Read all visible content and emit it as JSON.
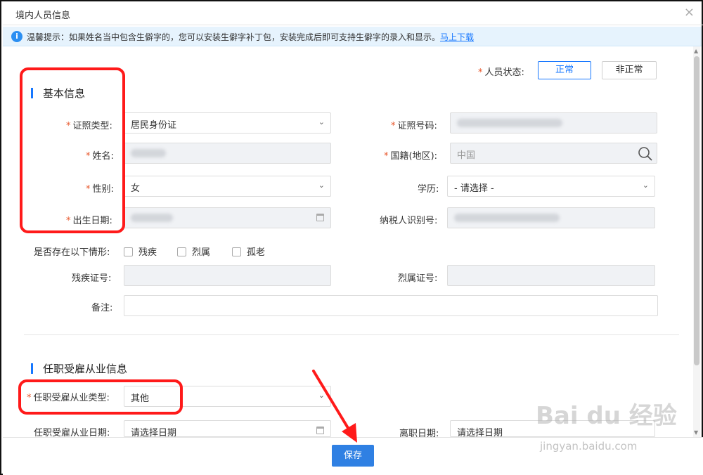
{
  "window": {
    "title": "境内人员信息",
    "close_symbol": "×"
  },
  "tip": {
    "icon_text": "i",
    "text": "温馨提示：如果姓名当中包含生僻字的，您可以安装生僻字补丁包，安装完成后即可支持生僻字的录入和显示。",
    "link": "马上下载"
  },
  "status": {
    "label": "人员状态:",
    "options": [
      "正常",
      "非正常"
    ],
    "selected": "正常"
  },
  "basic_section": {
    "title": "基本信息"
  },
  "fields": {
    "id_type": {
      "label": "证照类型:",
      "value": "居民身份证"
    },
    "id_number": {
      "label": "证照号码:"
    },
    "name": {
      "label": "姓名:"
    },
    "nationality": {
      "label": "国籍(地区):",
      "value": "中国"
    },
    "gender": {
      "label": "性别:",
      "value": "女"
    },
    "education": {
      "label": "学历:",
      "value": "- 请选择 -"
    },
    "birth_date": {
      "label": "出生日期:"
    },
    "taxpayer_id": {
      "label": "纳税人识别号:"
    },
    "situations": {
      "label": "是否存在以下情形:",
      "options": [
        "残疾",
        "烈属",
        "孤老"
      ]
    },
    "disability_cert": {
      "label": "残疾证号:"
    },
    "martyr_cert": {
      "label": "烈属证号:"
    },
    "remarks": {
      "label": "备注:"
    }
  },
  "employment_section": {
    "title": "任职受雇从业信息"
  },
  "employment": {
    "type": {
      "label": "任职受雇从业类型:",
      "value": "其他"
    },
    "start_date": {
      "label": "任职受雇从业日期:",
      "placeholder": "请选择日期"
    },
    "leave_date": {
      "label": "离职日期:",
      "placeholder": "请选择日期"
    }
  },
  "footer": {
    "save_label": "保存"
  },
  "watermark": {
    "logo": "Bai du 经验",
    "url": "jingyan.baidu.com"
  },
  "colors": {
    "accent": "#1677ff",
    "required": "#e8562a",
    "annotation": "#ff1a1a",
    "tip_bg": "#e6f3fd",
    "save_bg": "#2f80e3"
  }
}
